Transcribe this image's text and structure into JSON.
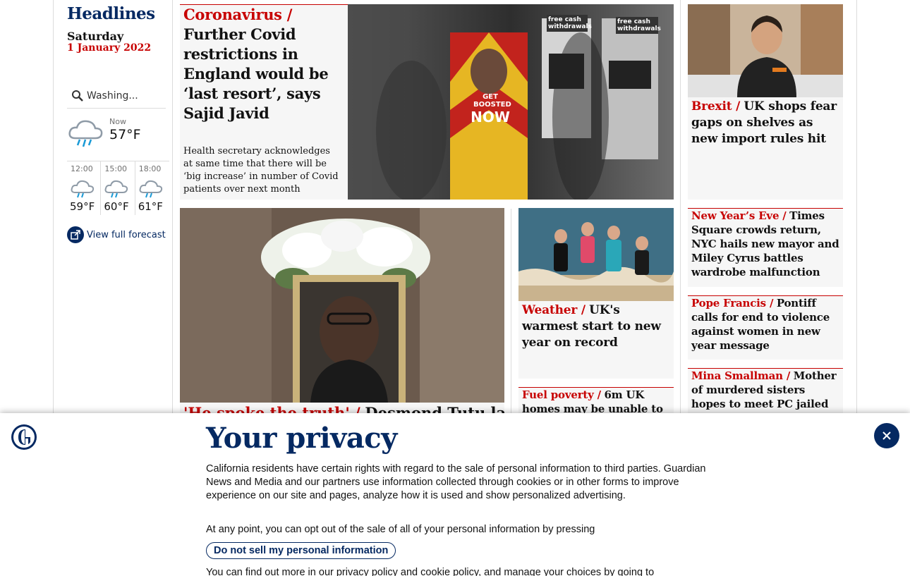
{
  "section": {
    "title": "Headlines",
    "day": "Saturday",
    "date": "1 January 2022"
  },
  "weather": {
    "location": "Washing...",
    "now_label": "Now",
    "now_temp": "57°F",
    "hours": [
      {
        "time": "12:00",
        "temp": "59°F"
      },
      {
        "time": "15:00",
        "temp": "60°F"
      },
      {
        "time": "18:00",
        "temp": "61°F"
      }
    ],
    "forecast_link": "View full forecast"
  },
  "stories": {
    "main": {
      "kicker": "Coronavirus /",
      "headline": "Further Covid restrictions in England would be ‘last resort’, says Sajid Javid",
      "standfirst": "Health secretary acknowledges at same time that there will be ‘big increase’ in number of Covid patients over next month",
      "image_text": [
        "free cash withdrawals",
        "free cash withdrawals",
        "GET BOOSTED",
        "NOW"
      ]
    },
    "brexit": {
      "kicker": "Brexit /",
      "headline": "UK shops fear gaps on shelves as new import rules hit"
    },
    "nye": {
      "kicker": "New Year’s Eve /",
      "headline": "Times Square crowds return, NYC hails new mayor and Miley Cyrus battles wardrobe malfunction"
    },
    "pope": {
      "kicker": "Pope Francis /",
      "headline": "Pontiff calls for end to violence against women in new year message"
    },
    "mina": {
      "kicker": "Mina Smallman /",
      "headline": "Mother of murdered sisters hopes to meet PC jailed for crime"
    },
    "weather": {
      "kicker": "Weather /",
      "headline": "UK's warmest start to new year on record"
    },
    "fuel": {
      "kicker": "Fuel poverty /",
      "headline": "6m UK homes may be unable to"
    },
    "tutu": {
      "kicker": "'He spoke the truth' /",
      "headline": "Desmond Tutu laid"
    }
  },
  "privacy": {
    "title": "Your privacy",
    "para1": "California residents have certain rights with regard to the sale of personal information to third parties. Guardian News and Media and our partners use information collected through cookies or in other forms to improve experience on our site and pages, analyze how it is used and show personalized advertising.",
    "para2": "At any point, you can opt out of the sale of all of your personal information by pressing",
    "button": "Do not sell my personal information",
    "para3": "You can find out more in our privacy policy and cookie policy, and manage your choices by going to"
  },
  "colors": {
    "brand": "#052962",
    "kicker": "#c70000",
    "card_bg": "#f6f6f6"
  }
}
